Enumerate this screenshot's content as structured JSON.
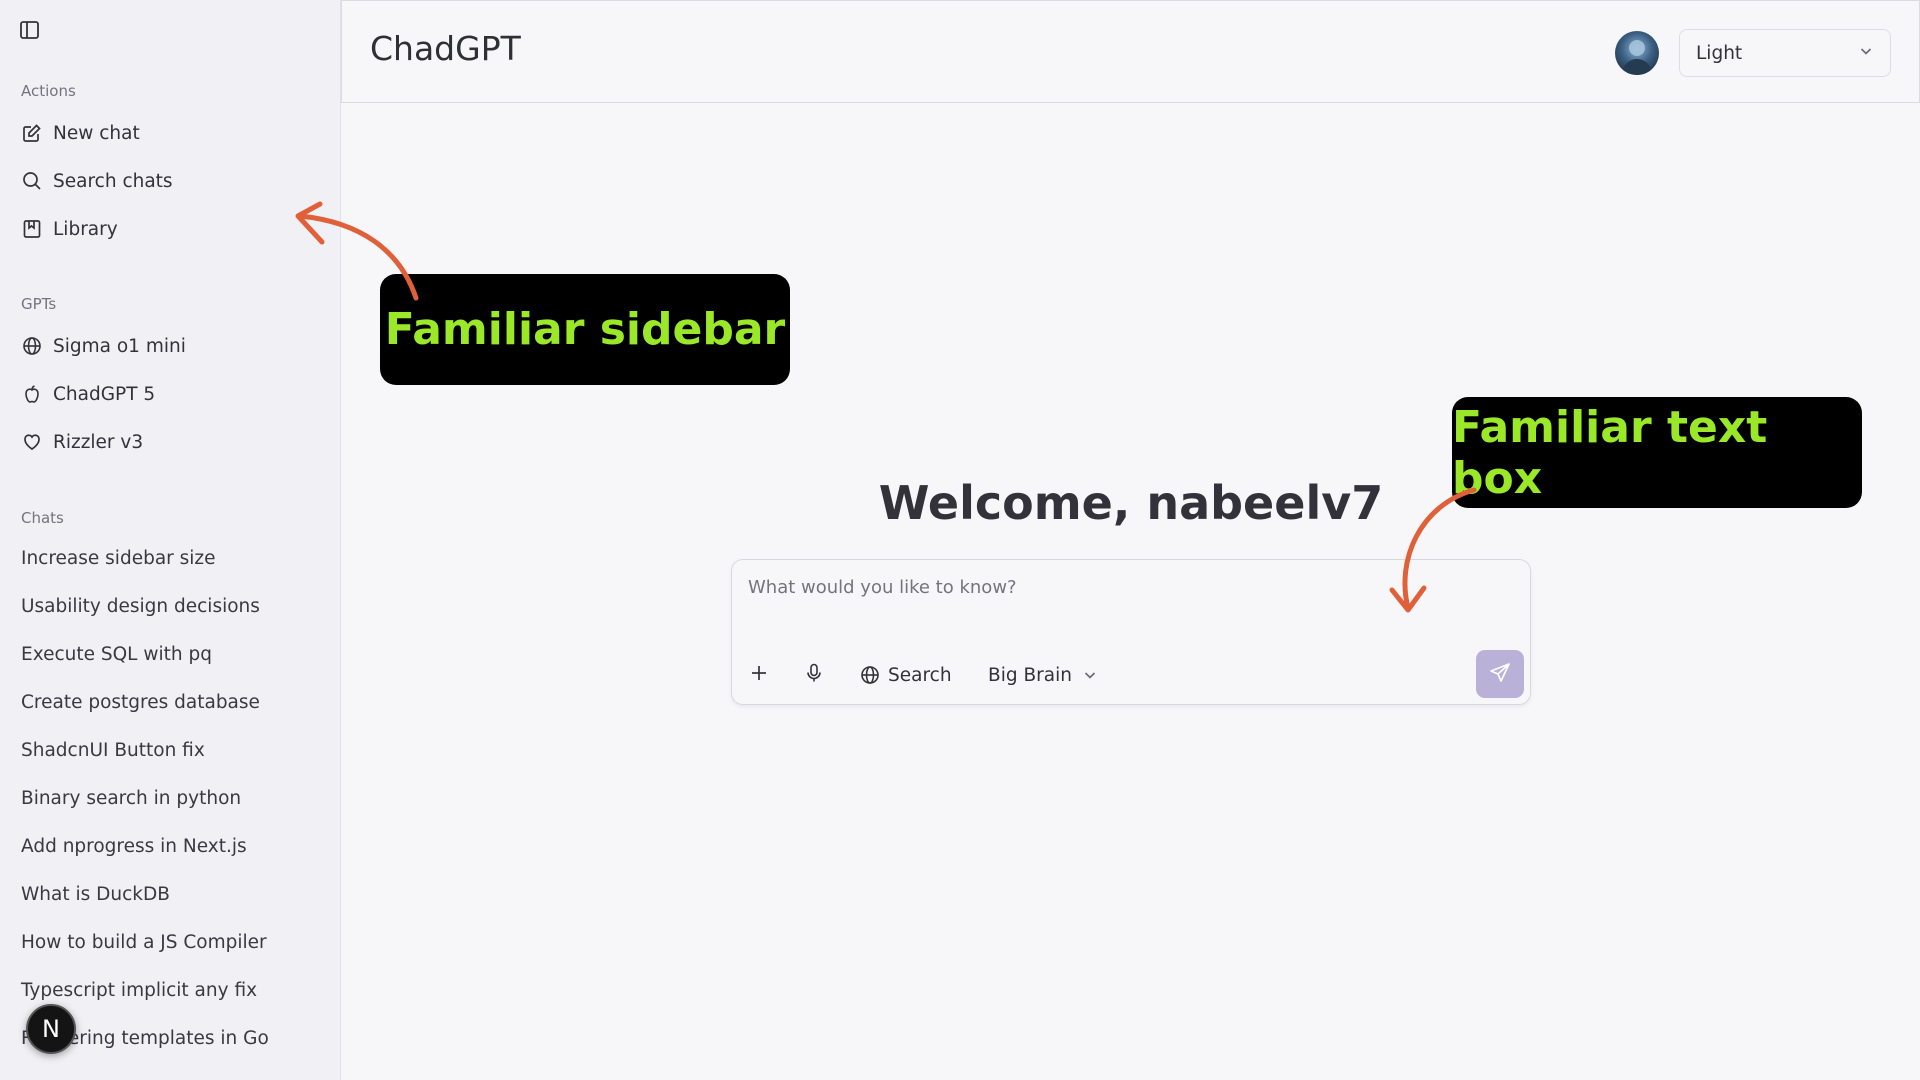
{
  "app": {
    "title": "ChadGPT"
  },
  "header": {
    "theme": {
      "selected": "Light"
    }
  },
  "sidebar": {
    "sections": {
      "actions": "Actions",
      "gpts": "GPTs",
      "chats": "Chats"
    },
    "actions": [
      {
        "label": "New chat",
        "icon": "edit-icon"
      },
      {
        "label": "Search chats",
        "icon": "search-icon"
      },
      {
        "label": "Library",
        "icon": "library-icon"
      }
    ],
    "gpts": [
      {
        "label": "Sigma o1 mini",
        "icon": "globe-icon"
      },
      {
        "label": "ChadGPT 5",
        "icon": "apple-icon"
      },
      {
        "label": "Rizzler v3",
        "icon": "heart-icon"
      }
    ],
    "chats": [
      "Increase sidebar size",
      "Usability design decisions",
      "Execute SQL with pq",
      "Create postgres database",
      "ShadcnUI Button fix",
      "Binary search in python",
      "Add nprogress in Next.js",
      "What is DuckDB",
      "How to build a JS Compiler",
      "Typescript implicit any fix",
      "Rendering templates in Go"
    ],
    "badge": "N"
  },
  "main": {
    "welcome": "Welcome, nabeelv7",
    "composer": {
      "placeholder": "What would you like to know?",
      "search_label": "Search",
      "model_label": "Big Brain"
    }
  },
  "annotations": {
    "sidebar_callout": "Familiar sidebar",
    "textbox_callout": "Familiar text box"
  },
  "colors": {
    "callout_text": "#9be829",
    "arrow": "#e0603a",
    "send_button": "#b9b1d8"
  }
}
